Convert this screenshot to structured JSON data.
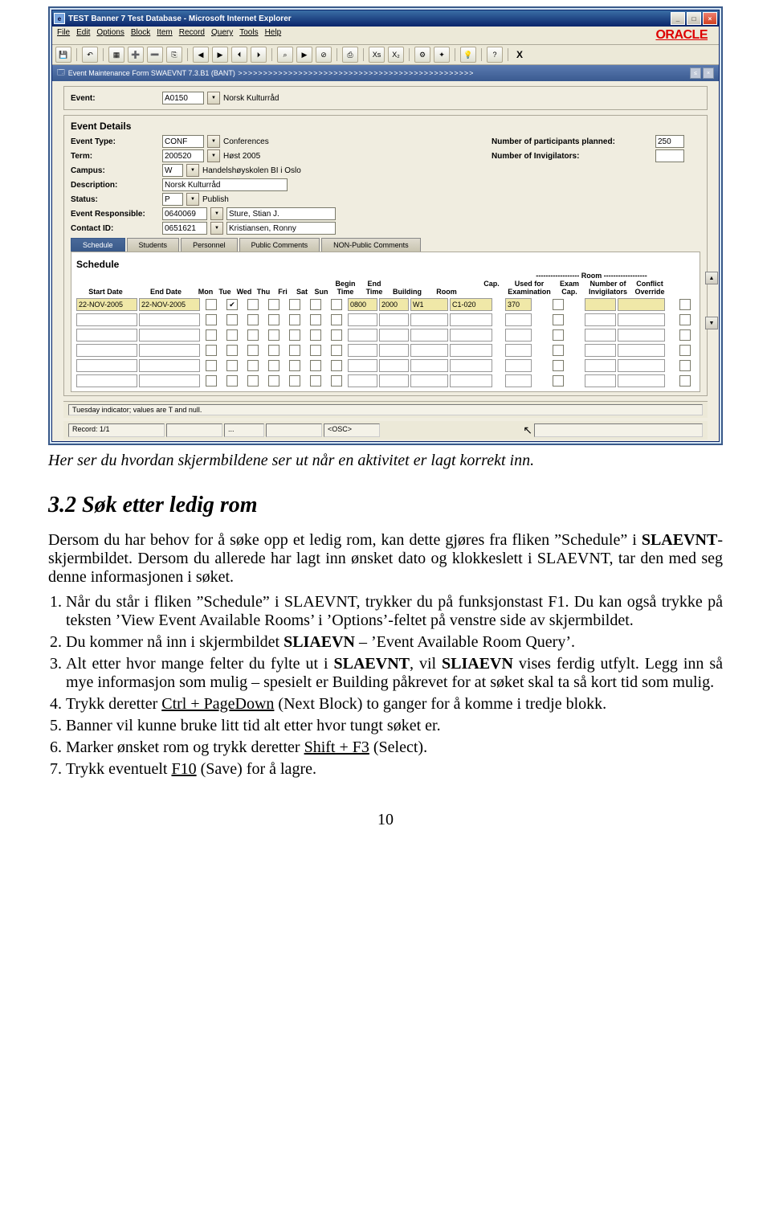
{
  "browser": {
    "title": "TEST Banner 7 Test Database - Microsoft Internet Explorer",
    "menu": [
      "File",
      "Edit",
      "Options",
      "Block",
      "Item",
      "Record",
      "Query",
      "Tools",
      "Help"
    ],
    "oracle": "ORACLE",
    "toolbar_x": "X"
  },
  "form": {
    "title": "Event Maintenance Form   SWAEVNT 7.3.B1 (BANT)",
    "event_lbl": "Event:",
    "event_code": "A0150",
    "event_name": "Norsk Kulturråd"
  },
  "details": {
    "section": "Event Details",
    "type_lbl": "Event Type:",
    "type_code": "CONF",
    "type_name": "Conferences",
    "term_lbl": "Term:",
    "term_code": "200520",
    "term_name": "Høst 2005",
    "campus_lbl": "Campus:",
    "campus_code": "W",
    "campus_name": "Handelshøyskolen BI i Oslo",
    "desc_lbl": "Description:",
    "desc_val": "Norsk Kulturråd",
    "status_lbl": "Status:",
    "status_code": "P",
    "status_name": "Publish",
    "resp_lbl": "Event Responsible:",
    "resp_code": "0640069",
    "resp_name": "Sture, Stian J.",
    "contact_lbl": "Contact ID:",
    "contact_code": "0651621",
    "contact_name": "Kristiansen, Ronny",
    "participants_lbl": "Number of participants planned:",
    "participants_val": "250",
    "invig_lbl": "Number of Invigilators:"
  },
  "tabs": [
    "Schedule",
    "Students",
    "Personnel",
    "Public Comments",
    "NON-Public Comments"
  ],
  "schedule": {
    "title": "Schedule",
    "cols": {
      "start": "Start Date",
      "end": "End Date",
      "mon": "Mon",
      "tue": "Tue",
      "wed": "Wed",
      "thu": "Thu",
      "fri": "Fri",
      "sat": "Sat",
      "sun": "Sun",
      "begin": "Begin\nTime",
      "endt": "End\nTime",
      "bldg": "Building",
      "room": "Room",
      "cap": "Cap.",
      "used": "Used for\nExamination",
      "ecap": "Exam\nCap.",
      "ninv": "Number of\nInvigilators",
      "conf": "Conflict\nOverride"
    },
    "room_hdr": "------------------ Room ------------------",
    "row1": {
      "start": "22-NOV-2005",
      "end": "22-NOV-2005",
      "begin": "0800",
      "endt": "2000",
      "bldg": "W1",
      "room": "C1-020",
      "cap": "370",
      "tue": true
    }
  },
  "status": {
    "hint": "Tuesday indicator; values are T and null.",
    "rec": "Record: 1/1",
    "dots": "...",
    "osc": "<OSC>"
  },
  "caption": "Her ser du hvordan skjermbildene ser ut når en aktivitet er lagt korrekt inn.",
  "h2": "3.2 Søk etter ledig rom",
  "p1": "Dersom du har behov for å søke opp et ledig rom, kan dette gjøres fra fliken \"Schedule\" i SLAEVNT-skjermbildet. Dersom du allerede har lagt inn ønsket dato og klokkeslett i SLAEVNT, tar den med seg denne informasjonen i søket.",
  "li": [
    "Når du står i fliken \"Schedule\" i SLAEVNT, trykker du på funksjonstast F1. Du kan også trykke på teksten 'View Event Available Rooms' i 'Options'-feltet på venstre side av skjermbildet.",
    "Du kommer nå inn i skjermbildet SLIAEVN – 'Event Available Room Query'.",
    "Alt etter hvor mange felter du fylte ut i SLAEVNT, vil SLIAEVN vises ferdig utfylt. Legg inn så mye informasjon som mulig – spesielt er Building påkrevet for at søket skal ta så kort tid som mulig.",
    "Trykk deretter Ctrl + PageDown (Next Block) to ganger for å komme i tredje blokk.",
    "Banner vil kunne bruke litt tid alt etter hvor tungt søket er.",
    "Marker ønsket rom og trykk deretter Shift + F3 (Select).",
    "Trykk eventuelt F10 (Save) for å lagre."
  ],
  "pgnum": "10"
}
